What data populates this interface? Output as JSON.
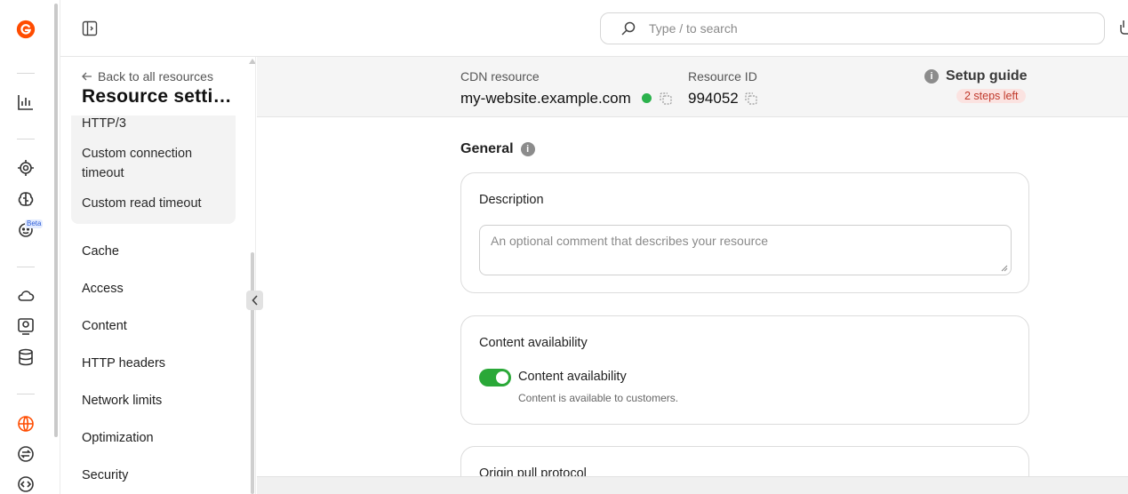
{
  "search": {
    "placeholder": "Type / to search"
  },
  "settings": {
    "back_label": "Back to all resources",
    "title": "Resource settings",
    "sub_items": [
      "HTTP/3",
      "Custom connection timeout",
      "Custom read timeout"
    ],
    "nav_items": [
      "Cache",
      "Access",
      "Content",
      "HTTP headers",
      "Network limits",
      "Optimization",
      "Security"
    ]
  },
  "rail": {
    "beta_label": "Beta"
  },
  "resource": {
    "cdn_label": "CDN resource",
    "cdn_value": "my-website.example.com",
    "id_label": "Resource ID",
    "id_value": "994052",
    "guide_label": "Setup guide",
    "guide_badge": "2 steps left"
  },
  "general": {
    "section_title": "General",
    "description_title": "Description",
    "description_placeholder": "An optional comment that describes your resource",
    "availability_title": "Content availability",
    "availability_toggle_label": "Content availability",
    "availability_desc": "Content is available to customers.",
    "availability_enabled": true,
    "origin_title": "Origin pull protocol"
  },
  "colors": {
    "brand": "#ff4c00",
    "toggle_on": "#2aa838",
    "status_ok": "#2bb24c",
    "badge_text": "#c0392b",
    "badge_bg": "#fbe3e1"
  }
}
